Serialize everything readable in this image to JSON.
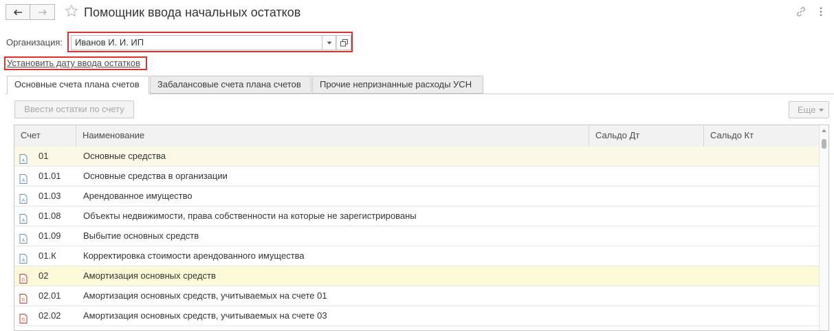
{
  "header": {
    "title": "Помощник ввода начальных остатков",
    "back_icon": "arrow-left-icon",
    "forward_icon": "arrow-right-icon",
    "favorite_icon": "star-icon",
    "link_icon": "link-icon",
    "more_icon": "more-vertical-icon"
  },
  "org": {
    "label": "Организация:",
    "value": "Иванов И. И. ИП"
  },
  "date_link": "Установить дату ввода остатков",
  "tabs": [
    {
      "label": "Основные счета плана счетов",
      "active": true
    },
    {
      "label": "Забалансовые счета плана счетов",
      "active": false
    },
    {
      "label": "Прочие непризнанные расходы УСН",
      "active": false
    }
  ],
  "toolbar": {
    "enter_balances": "Ввести остатки по счету",
    "more": "Еще"
  },
  "table": {
    "columns": [
      "Счет",
      "Наименование",
      "Сальдо Дт",
      "Сальдо Кт"
    ],
    "rows": [
      {
        "code": "01",
        "name": "Основные средства",
        "icon": "active-account-icon"
      },
      {
        "code": "01.01",
        "name": "Основные средства в организации",
        "icon": "active-account-icon"
      },
      {
        "code": "01.03",
        "name": "Арендованное имущество",
        "icon": "active-account-icon"
      },
      {
        "code": "01.08",
        "name": "Объекты недвижимости, права собственности на которые не зарегистрированы",
        "icon": "active-account-icon"
      },
      {
        "code": "01.09",
        "name": "Выбытие основных средств",
        "icon": "active-account-icon"
      },
      {
        "code": "01.К",
        "name": "Корректировка стоимости арендованного имущества",
        "icon": "active-account-icon"
      },
      {
        "code": "02",
        "name": "Амортизация основных средств",
        "icon": "passive-account-icon"
      },
      {
        "code": "02.01",
        "name": "Амортизация основных средств, учитываемых на счете 01",
        "icon": "passive-account-icon"
      },
      {
        "code": "02.02",
        "name": "Амортизация основных средств, учитываемых на счете 03",
        "icon": "passive-account-icon"
      }
    ]
  },
  "colors": {
    "highlight_border": "#d8312e",
    "row_selected": "#fbf9e6",
    "row_group": "#fbf9d8",
    "passive_icon": "#c0392b"
  }
}
